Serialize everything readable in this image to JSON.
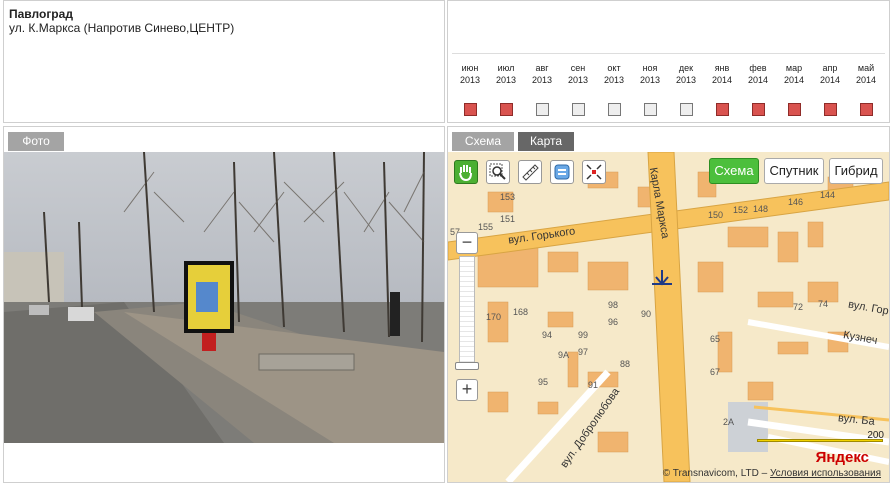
{
  "info": {
    "city": "Павлоград",
    "address": "ул. К.Маркса (Напротив Синево,ЦЕНТР)"
  },
  "calendar": [
    {
      "month": "июн",
      "year": "2013",
      "active": true
    },
    {
      "month": "июл",
      "year": "2013",
      "active": true
    },
    {
      "month": "авг",
      "year": "2013",
      "active": false
    },
    {
      "month": "сен",
      "year": "2013",
      "active": false
    },
    {
      "month": "окт",
      "year": "2013",
      "active": false
    },
    {
      "month": "ноя",
      "year": "2013",
      "active": false
    },
    {
      "month": "дек",
      "year": "2013",
      "active": false
    },
    {
      "month": "янв",
      "year": "2014",
      "active": true
    },
    {
      "month": "фев",
      "year": "2014",
      "active": true
    },
    {
      "month": "мар",
      "year": "2014",
      "active": true
    },
    {
      "month": "апр",
      "year": "2014",
      "active": true
    },
    {
      "month": "май",
      "year": "2014",
      "active": true
    }
  ],
  "photo": {
    "tab_label": "Фото"
  },
  "map": {
    "tabs": [
      {
        "label": "Схема"
      },
      {
        "label": "Карта"
      }
    ],
    "layers": {
      "scheme": "Схема",
      "satellite": "Спутник",
      "hybrid": "Гибрид"
    },
    "streets": {
      "gorkogo": "вул. Горького",
      "marksa": "Карла Маркса",
      "dobrolyubova": "вул. Добролюбова",
      "kuznech": "Кузнеч",
      "vul1": "вул. Ба",
      "vul2": "вул. Гор"
    },
    "scale": "200",
    "logo": "Яндекс",
    "copyright_text": "© Transnavicom, LTD – ",
    "copyright_link": "Условия использования",
    "house_numbers": [
      "153",
      "151",
      "155",
      "57",
      "148",
      "146",
      "144",
      "150",
      "152",
      "170",
      "168",
      "98",
      "96",
      "90",
      "99",
      "97",
      "88",
      "94",
      "9А",
      "95",
      "91",
      "65",
      "67",
      "72",
      "74",
      "2А"
    ]
  },
  "colors": {
    "active_month": "#d9534f",
    "map_bg": "#f6e9c9",
    "road": "#f7c25c",
    "building": "#f0b46f"
  }
}
